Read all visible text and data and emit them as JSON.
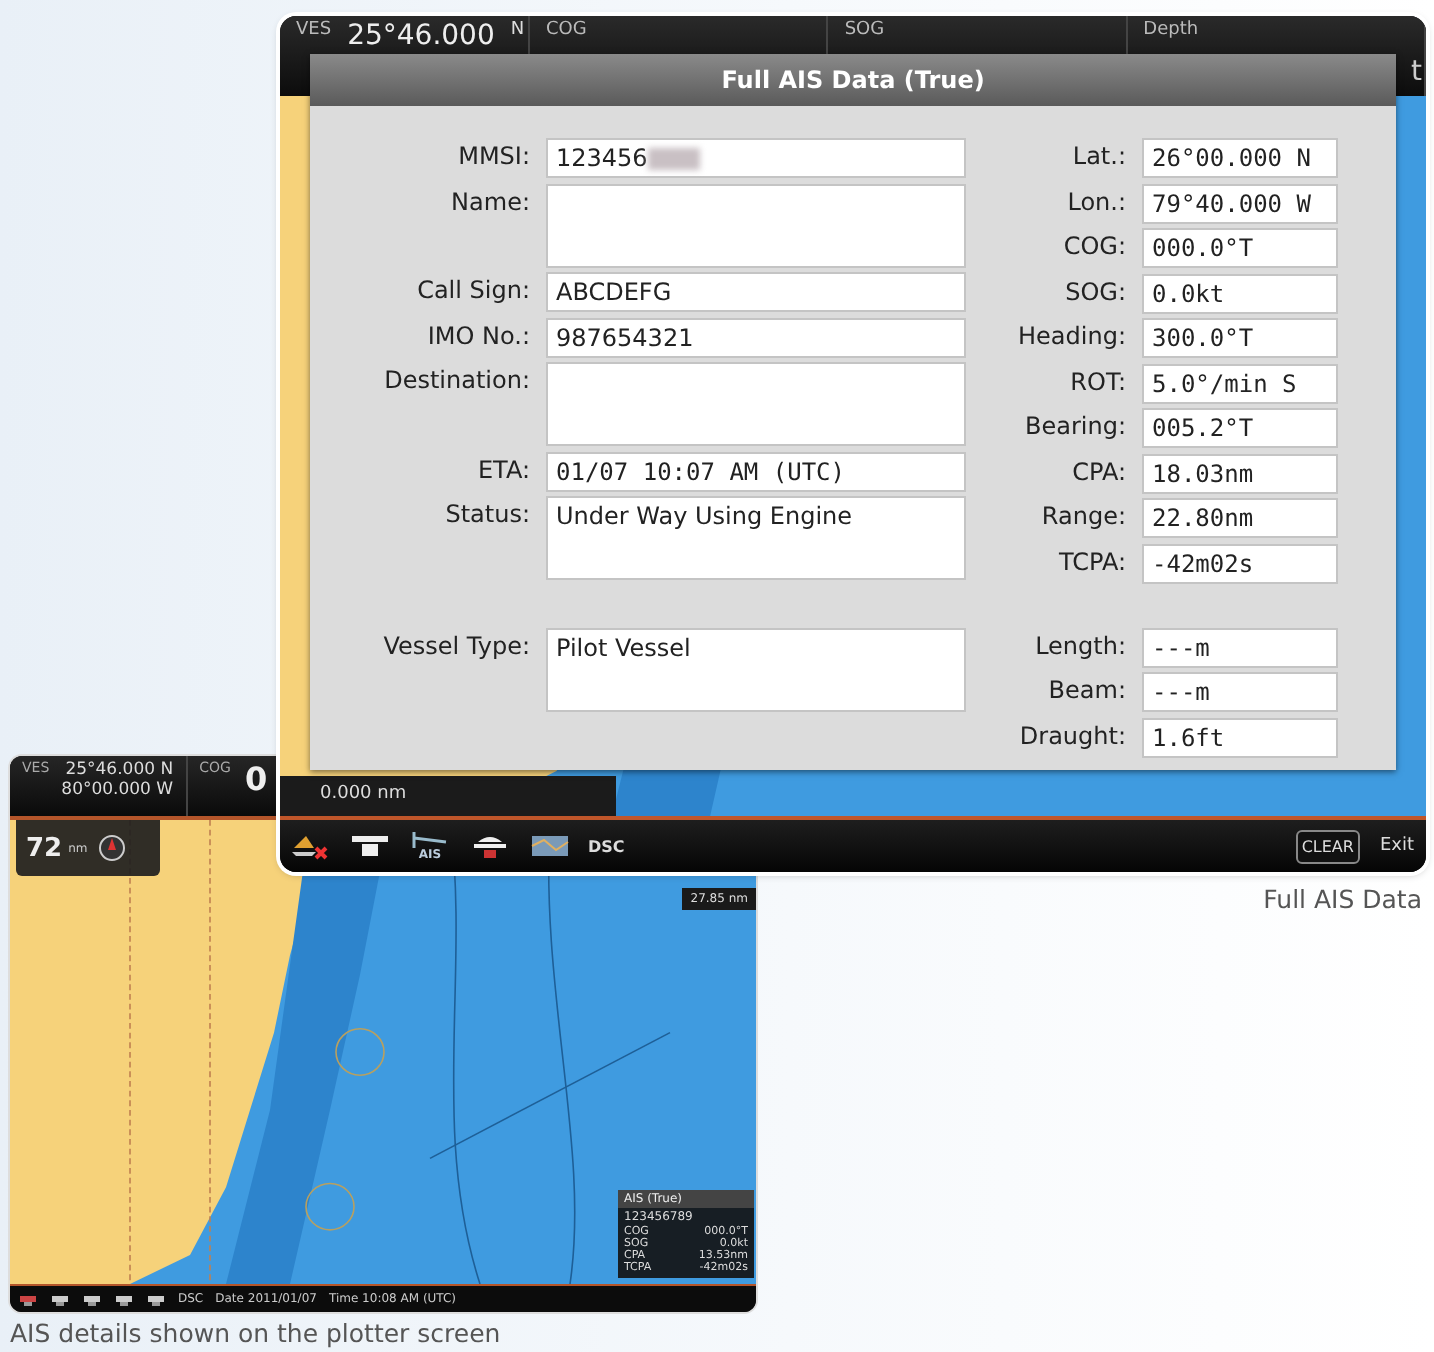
{
  "main_screen": {
    "top_bar": [
      {
        "label": "VES",
        "value": "25°46.000",
        "unit": "N"
      },
      {
        "label": "COG"
      },
      {
        "label": "SOG"
      },
      {
        "label": "Depth"
      }
    ],
    "edge_text": "t",
    "dialog": {
      "title": "Full AIS Data (True)",
      "left_fields": [
        {
          "label": "MMSI:",
          "value": "123456",
          "kind": "masked"
        },
        {
          "label": "Name:",
          "kind": "tall"
        },
        {
          "label": "Call Sign:",
          "value": "ABCDEFG",
          "kind": "text"
        },
        {
          "label": "IMO No.:",
          "value": "987654321",
          "kind": "text"
        },
        {
          "label": "Destination:",
          "kind": "tall"
        },
        {
          "label": "ETA:",
          "value": "01/07 10:07 AM (UTC)",
          "kind": "mono"
        },
        {
          "label": "Status:",
          "value": "Under Way Using Engine",
          "kind": "tall"
        }
      ],
      "right_fields": [
        {
          "label": "Lat.:",
          "value": "26°00.000 N",
          "kind": "mono"
        },
        {
          "label": "Lon.:",
          "value": "79°40.000 W",
          "kind": "mono"
        },
        {
          "label": "COG:",
          "value": "000.0°T",
          "kind": "mono"
        },
        {
          "label": "SOG:",
          "value": "0.0kt",
          "kind": "mono"
        },
        {
          "label": "Heading:",
          "value": "300.0°T",
          "kind": "mono"
        },
        {
          "label": "ROT:",
          "value": "5.0°/min S",
          "kind": "mono"
        },
        {
          "label": "Bearing:",
          "value": "005.2°T",
          "kind": "mono"
        },
        {
          "label": "CPA:",
          "value": "18.03nm",
          "kind": "mono"
        },
        {
          "label": "Range:",
          "value": "22.80nm",
          "kind": "mono"
        },
        {
          "label": "TCPA:",
          "value": "-42m02s",
          "kind": "mono"
        }
      ],
      "lower_left_fields": [
        {
          "label": "Vessel Type:",
          "value": "Pilot Vessel",
          "kind": "tall"
        }
      ],
      "lower_right_fields": [
        {
          "label": "Length:",
          "value": "---m",
          "kind": "mono"
        },
        {
          "label": "Beam:",
          "value": "---m",
          "kind": "mono"
        },
        {
          "label": "Draught:",
          "value": "1.6ft",
          "kind": "mono"
        }
      ]
    },
    "range_readout": "0.000 nm",
    "toolbar": {
      "ais_label": "AIS",
      "dsc": "DSC",
      "clear": "CLEAR",
      "exit": "Exit"
    }
  },
  "main_caption": "Full AIS Data",
  "plotter_screen": {
    "ves_label": "VES",
    "latitude": "25°46.000 N",
    "longitude": "80°00.000 W",
    "cog_label": "COG",
    "cog_value": "0",
    "range_gadget": {
      "value": "72",
      "unit": "nm"
    },
    "distance_readout": "27.85 nm",
    "ais_panel": {
      "title": "AIS (True)",
      "mmsi": "123456789",
      "rows": [
        {
          "label": "COG",
          "value": "000.0°T"
        },
        {
          "label": "SOG",
          "value": "0.0kt"
        },
        {
          "label": "CPA",
          "value": "13.53nm"
        },
        {
          "label": "TCPA",
          "value": "-42m02s"
        }
      ]
    },
    "bottom_bar": {
      "dsc": "DSC",
      "date": "Date 2011/01/07",
      "time": "Time 10:08 AM (UTC)"
    }
  },
  "plotter_caption": "AIS details shown on the plotter screen"
}
